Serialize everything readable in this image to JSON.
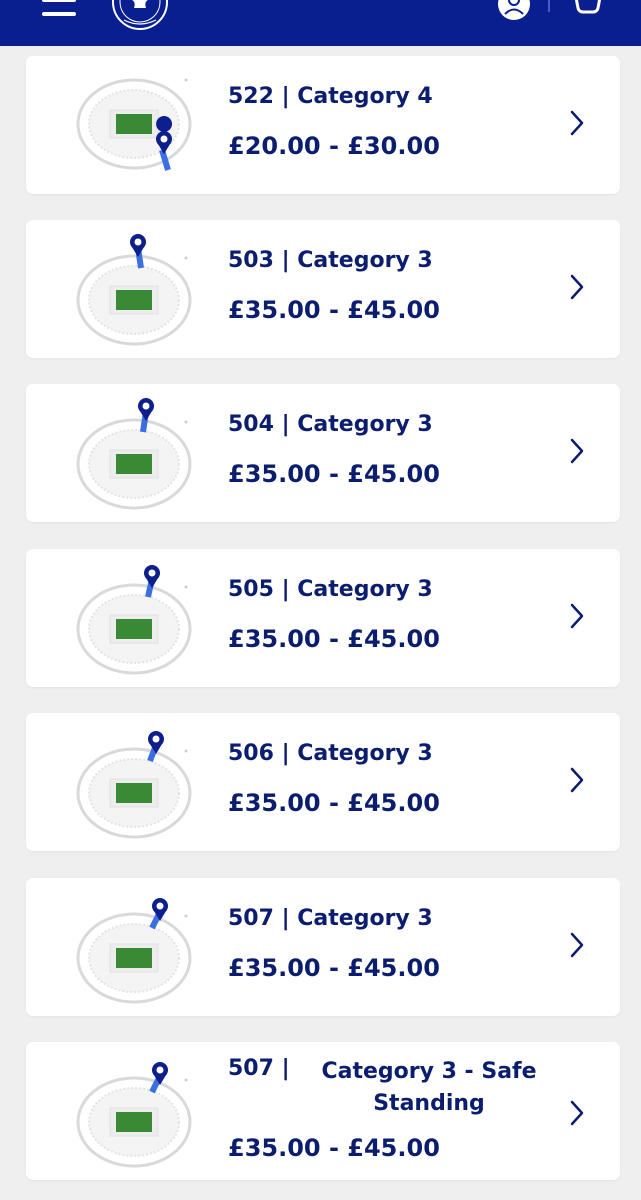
{
  "header": {
    "icons": [
      "menu-icon",
      "club-crest-icon",
      "account-icon",
      "basket-icon"
    ],
    "background": "#0a1f8f"
  },
  "sections": [
    {
      "title": "522 | Category 4",
      "price": "£20.00 - £30.00",
      "pin": "bottom-right"
    },
    {
      "title": "503 | Category 3",
      "price": "£35.00 - £45.00",
      "pin": "top-center"
    },
    {
      "title": "504 | Category 3",
      "price": "£35.00 - £45.00",
      "pin": "top-center-right"
    },
    {
      "title": "505 | Category 3",
      "price": "£35.00 - £45.00",
      "pin": "top-right"
    },
    {
      "title": "506 | Category 3",
      "price": "£35.00 - £45.00",
      "pin": "top-right"
    },
    {
      "title": "507 | Category 3",
      "price": "£35.00 - £45.00",
      "pin": "top-right"
    },
    {
      "title_number": "507 |",
      "title_category": "Category 3 - Safe Standing",
      "price": "£35.00 - £45.00",
      "pin": "top-right"
    }
  ],
  "colors": {
    "brand": "#0a1f8f",
    "text": "#0b1d6e",
    "pin": "#0d1f8c",
    "pin_stem": "#3b6fe0",
    "pitch": "#3a8a35"
  }
}
